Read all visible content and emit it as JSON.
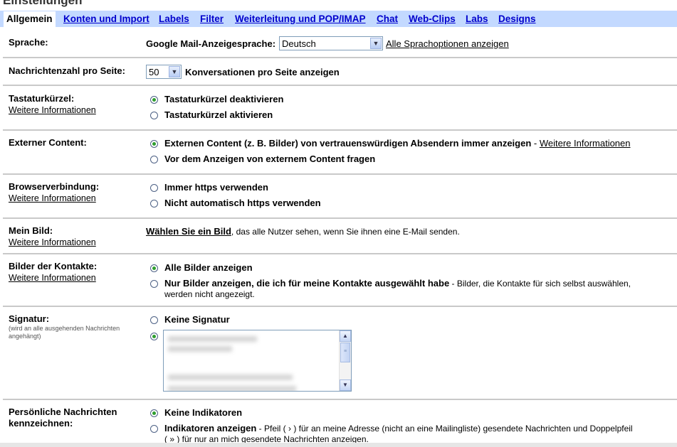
{
  "header": {
    "title": "Einstellungen"
  },
  "tabs": [
    {
      "label": "Allgemein",
      "active": true
    },
    {
      "label": "Konten und Import"
    },
    {
      "label": "Labels"
    },
    {
      "label": "Filter"
    },
    {
      "label": "Weiterleitung und POP/IMAP"
    },
    {
      "label": "Chat"
    },
    {
      "label": "Web-Clips"
    },
    {
      "label": "Labs"
    },
    {
      "label": "Designs"
    }
  ],
  "sprache": {
    "label": "Sprache:",
    "prefix": "Google Mail-Anzeigesprache:",
    "selected": "Deutsch",
    "link": "Alle Sprachoptionen anzeigen"
  },
  "pagesize": {
    "label": "Nachrichtenzahl pro Seite:",
    "selected": "50",
    "suffix": "Konversationen pro Seite anzeigen"
  },
  "tastatur": {
    "label": "Tastaturkürzel:",
    "more": "Weitere Informationen",
    "options": [
      "Tastaturkürzel deaktivieren",
      "Tastaturkürzel aktivieren"
    ]
  },
  "extern": {
    "label": "Externer Content:",
    "option1": "Externen Content (z. B. Bilder) von vertrauenswürdigen Absendern immer anzeigen",
    "sep": " - ",
    "more": "Weitere Informationen",
    "option2": "Vor dem Anzeigen von externem Content fragen"
  },
  "browser": {
    "label": "Browserverbindung:",
    "more": "Weitere Informationen",
    "options": [
      "Immer https verwenden",
      "Nicht automatisch https verwenden"
    ]
  },
  "bild": {
    "label": "Mein Bild:",
    "more": "Weitere Informationen",
    "link": "Wählen Sie ein Bild",
    "text": ", das alle Nutzer sehen, wenn Sie ihnen eine E-Mail senden."
  },
  "kontakte": {
    "label": "Bilder der Kontakte:",
    "more": "Weitere Informationen",
    "option1": "Alle Bilder anzeigen",
    "option2": "Nur Bilder anzeigen, die ich für meine Kontakte ausgewählt habe",
    "option2_note1": " - Bilder, die Kontakte für sich selbst auswählen,",
    "option2_note2": "werden nicht angezeigt."
  },
  "signatur": {
    "label": "Signatur:",
    "note": "(wird an alle ausgehenden Nachrichten angehängt)",
    "option1": "Keine Signatur"
  },
  "persoenlich": {
    "label_line1": "Persönliche Nachrichten",
    "label_line2": "kennzeichnen:",
    "option1": "Keine Indikatoren",
    "option2": "Indikatoren anzeigen",
    "option2_note1": " - Pfeil ( › ) für an meine Adresse (nicht an eine Mailingliste) gesendete Nachrichten und Doppelpfeil",
    "option2_note2": "( » ) für nur an mich gesendete Nachrichten anzeigen."
  }
}
